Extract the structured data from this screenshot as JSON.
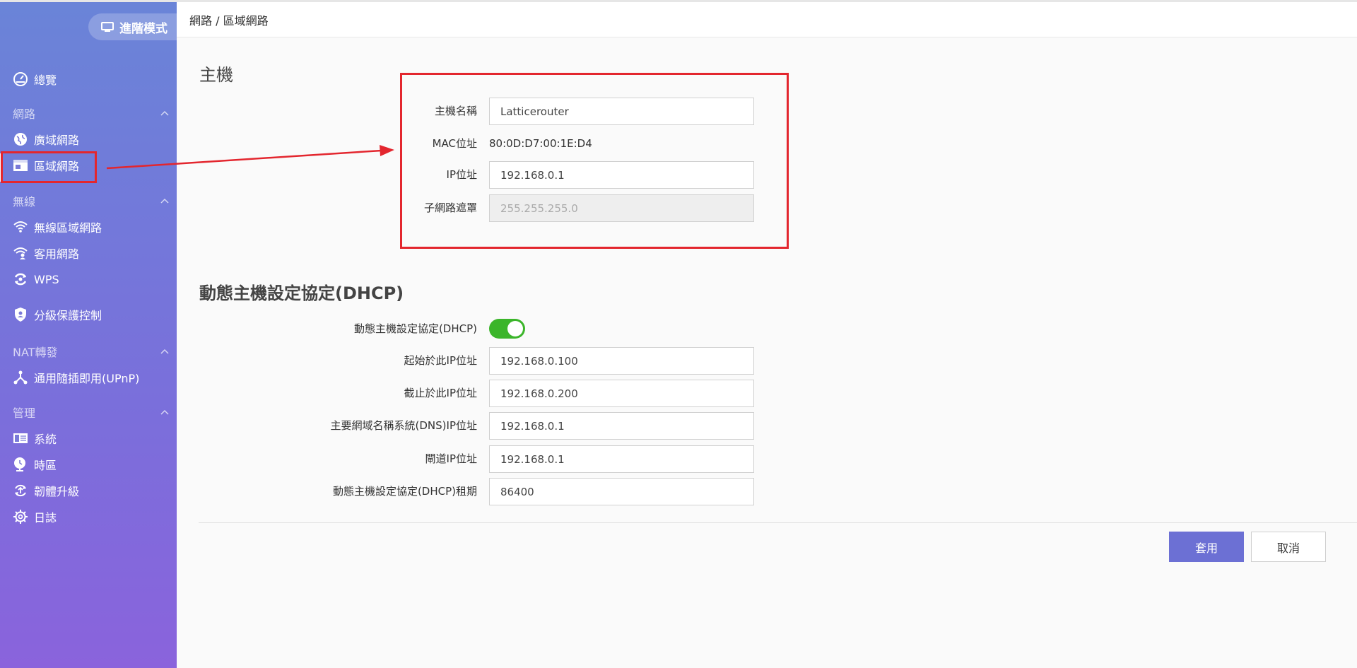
{
  "mode_button": "進階模式",
  "breadcrumb": "網路 / 區域網路",
  "sidebar": {
    "overview": "總覽",
    "sections": {
      "network": "網路",
      "wireless": "無線",
      "nat": "NAT轉發",
      "management": "管理"
    },
    "items": {
      "wan": "廣域網路",
      "lan": "區域網路",
      "wlan": "無線區域網路",
      "guest": "客用網路",
      "wps": "WPS",
      "parental": "分級保護控制",
      "upnp": "通用隨插即用(UPnP)",
      "system": "系統",
      "timezone": "時區",
      "firmware": "韌體升級",
      "log": "日誌"
    }
  },
  "host": {
    "title": "主機",
    "hostname_label": "主機名稱",
    "hostname_value": "Latticerouter",
    "mac_label": "MAC位址",
    "mac_value": "80:0D:D7:00:1E:D4",
    "ip_label": "IP位址",
    "ip_value": "192.168.0.1",
    "subnet_label": "子網路遮罩",
    "subnet_value": "255.255.255.0"
  },
  "dhcp": {
    "title": "動態主機設定協定(DHCP)",
    "enable_label": "動態主機設定協定(DHCP)",
    "enabled": true,
    "start_label": "起始於此IP位址",
    "start_value": "192.168.0.100",
    "end_label": "截止於此IP位址",
    "end_value": "192.168.0.200",
    "dns_label": "主要網域名稱系統(DNS)IP位址",
    "dns_value": "192.168.0.1",
    "gateway_label": "閘道IP位址",
    "gateway_value": "192.168.0.1",
    "lease_label": "動態主機設定協定(DHCP)租期",
    "lease_value": "86400"
  },
  "buttons": {
    "apply": "套用",
    "cancel": "取消"
  },
  "colors": {
    "accent": "#6c70d4",
    "toggle_on": "#3bb52a",
    "annotation": "#e3262e"
  }
}
